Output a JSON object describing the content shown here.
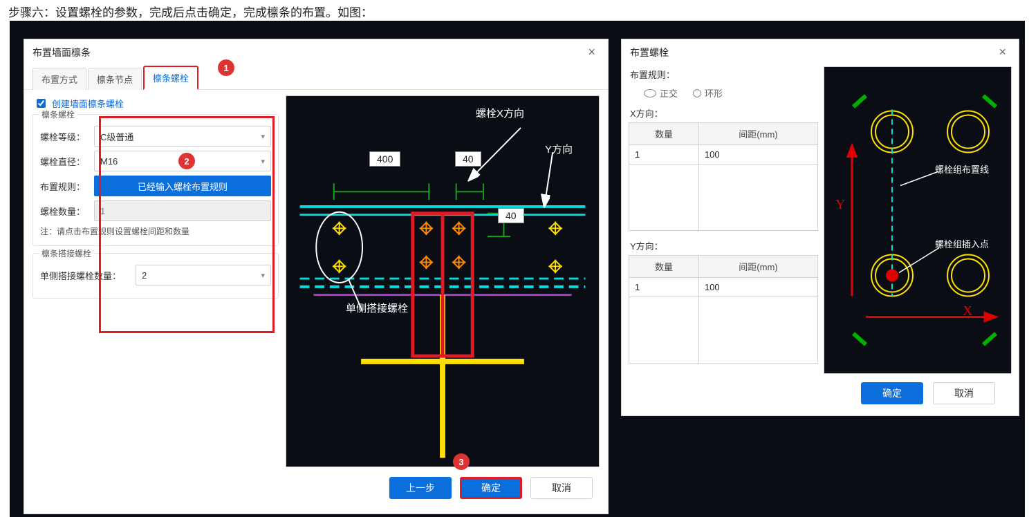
{
  "instruction": "步骤六：设置螺栓的参数，完成后点击确定，完成檩条的布置。如图：",
  "callouts": {
    "c1": "1",
    "c2": "2",
    "c3": "3"
  },
  "dlg_left": {
    "title": "布置墙面檩条",
    "tabs": {
      "t1": "布置方式",
      "t2": "檩条节点",
      "t3": "檩条螺栓"
    },
    "create_chk": "创建墙面檩条螺栓",
    "group1_title": "檩条螺栓",
    "bolt_grade_label": "螺栓等级：",
    "bolt_grade_value": "C级普通",
    "bolt_dia_label": "螺栓直径：",
    "bolt_dia_value": "M16",
    "rule_label": "布置规则：",
    "rule_btn": "已经输入螺栓布置规则",
    "bolt_qty_label": "螺栓数量：",
    "bolt_qty_value": "1",
    "note": "注：请点击布置规则设置螺栓间距和数量",
    "group2_title": "檩条搭接螺栓",
    "overlap_qty_label": "单侧搭接螺栓数量：",
    "overlap_qty_value": "2",
    "preview": {
      "dim_400": "400",
      "dim_40a": "40",
      "dim_40b": "40",
      "label_x": "螺栓X方向",
      "label_y": "Y方向",
      "label_overlap": "单侧搭接螺栓"
    },
    "btn_prev": "上一步",
    "btn_ok": "确定",
    "btn_cancel": "取消"
  },
  "dlg_right": {
    "title": "布置螺栓",
    "rule_label": "布置规则：",
    "radio_ortho": "正交",
    "radio_ring": "环形",
    "x_label": "X方向：",
    "y_label": "Y方向：",
    "col_qty": "数量",
    "col_spacing": "间距(mm)",
    "x_qty": "1",
    "x_spacing": "100",
    "y_qty": "1",
    "y_spacing": "100",
    "preview_note1": "螺栓组布置线",
    "preview_note2": "螺栓组插入点",
    "axis_y": "Y",
    "axis_x": "X",
    "btn_ok": "确定",
    "btn_cancel": "取消"
  }
}
